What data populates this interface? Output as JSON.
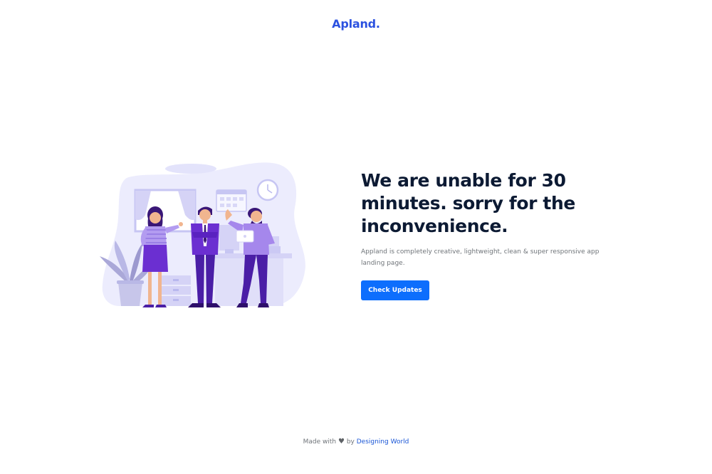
{
  "header": {
    "logo_text": "Apland."
  },
  "main": {
    "headline": "We are unable for 30 minutes. sorry for the inconvenience.",
    "description": "Appland is completely creative, lightweight, clean & super responsive app landing page.",
    "cta_label": "Check Updates",
    "illustration_icon": "office-team-illustration"
  },
  "footer": {
    "made_with": "Made with",
    "heart_icon": "heart-icon",
    "by": "by",
    "link_text": "Designing World"
  },
  "colors": {
    "brand": "#2c52e0",
    "button": "#0d6efd",
    "heading": "#0c1a33",
    "body_text": "#6f7479",
    "illustration_bg": "#eeeeff",
    "illustration_purple": "#6b2fd1"
  }
}
